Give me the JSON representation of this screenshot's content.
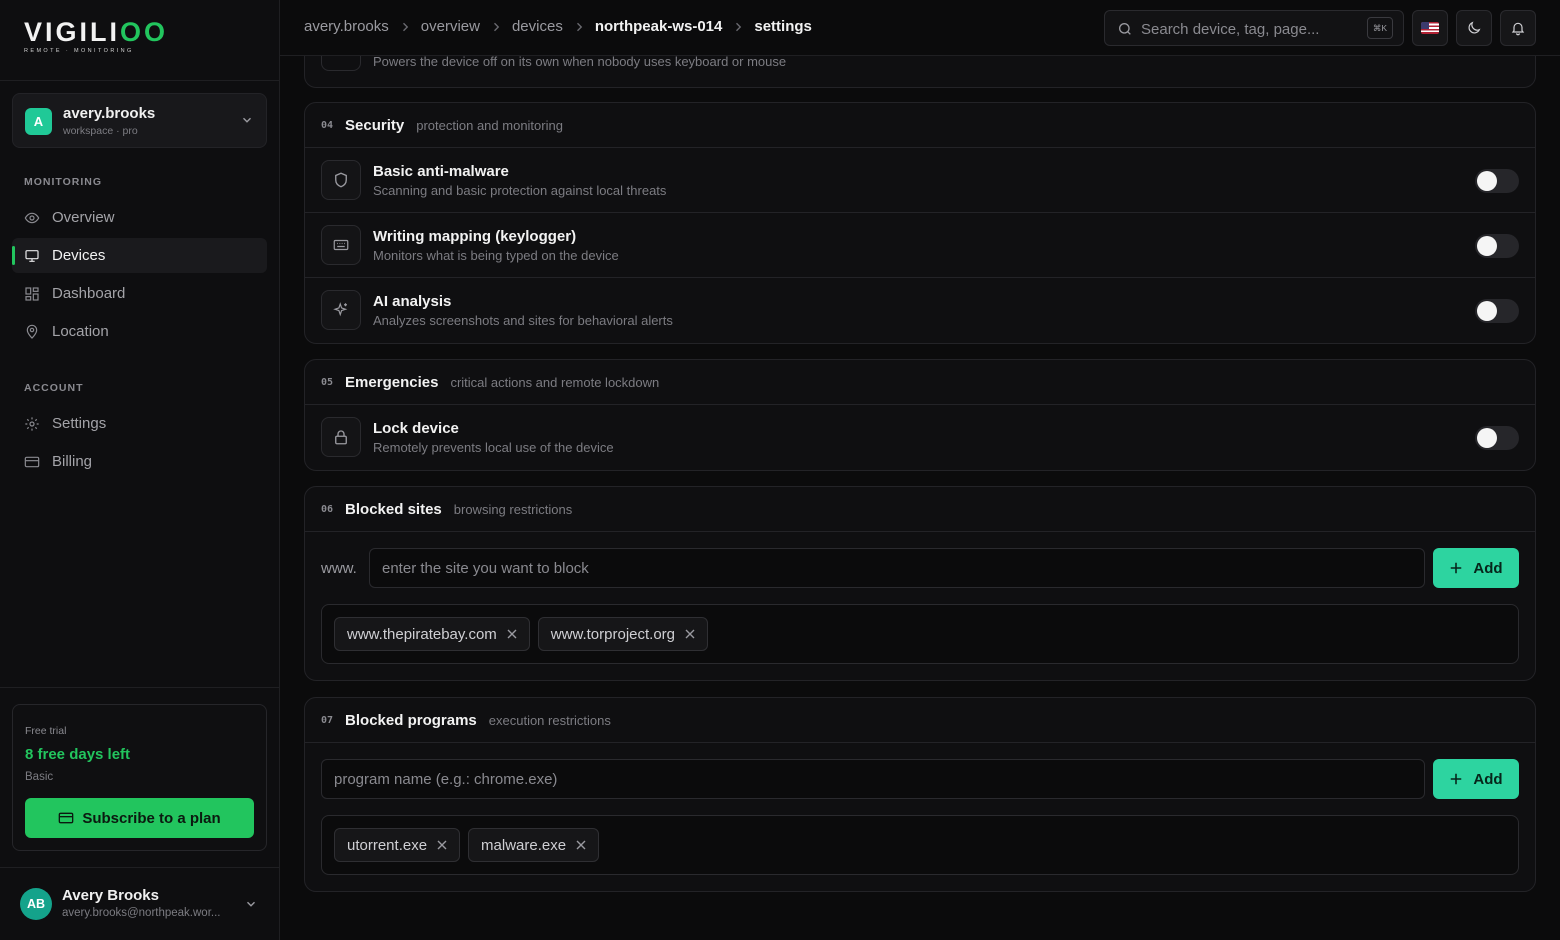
{
  "brand": {
    "name_main": "VIGILI",
    "name_accent": "OO",
    "tagline": "REMOTE · MONITORING"
  },
  "workspace": {
    "initial": "A",
    "name": "avery.brooks",
    "subtitle": "workspace · pro"
  },
  "sidebar": {
    "monitoring_label": "MONITORING",
    "monitoring_items": [
      {
        "label": "Overview",
        "icon": "eye-icon"
      },
      {
        "label": "Devices",
        "icon": "monitor-icon",
        "active": true
      },
      {
        "label": "Dashboard",
        "icon": "grid-icon"
      },
      {
        "label": "Location",
        "icon": "map-pin-icon"
      }
    ],
    "account_label": "ACCOUNT",
    "account_items": [
      {
        "label": "Settings",
        "icon": "gear-icon"
      },
      {
        "label": "Billing",
        "icon": "credit-card-icon"
      }
    ]
  },
  "trial": {
    "label": "Free trial",
    "days_left": "8 free days left",
    "plan": "Basic",
    "cta": "Subscribe to a plan"
  },
  "user": {
    "initials": "AB",
    "name": "Avery Brooks",
    "email": "avery.brooks@northpeak.wor..."
  },
  "breadcrumb": [
    "avery.brooks",
    "overview",
    "devices",
    "northpeak-ws-014",
    "settings"
  ],
  "search": {
    "placeholder": "Search device, tag, page...",
    "shortcut": "⌘K"
  },
  "partial_row": {
    "description": "Powers the device off on its own when nobody uses keyboard or mouse",
    "enabled": false
  },
  "security": {
    "number": "04",
    "title": "Security",
    "subtitle": "protection and monitoring",
    "rows": [
      {
        "title": "Basic anti-malware",
        "description": "Scanning and basic protection against local threats",
        "icon": "shield-icon",
        "enabled": false
      },
      {
        "title": "Writing mapping (keylogger)",
        "description": "Monitors what is being typed on the device",
        "icon": "keyboard-icon",
        "enabled": false
      },
      {
        "title": "AI analysis",
        "description": "Analyzes screenshots and sites for behavioral alerts",
        "icon": "sparkle-icon",
        "enabled": false
      }
    ]
  },
  "emergencies": {
    "number": "05",
    "title": "Emergencies",
    "subtitle": "critical actions and remote lockdown",
    "rows": [
      {
        "title": "Lock device",
        "description": "Remotely prevents local use of the device",
        "icon": "lock-icon",
        "enabled": false
      }
    ]
  },
  "blocked_sites": {
    "number": "06",
    "title": "Blocked sites",
    "subtitle": "browsing restrictions",
    "prefix": "www.",
    "placeholder": "enter the site you want to block",
    "add_label": "Add",
    "items": [
      "www.thepiratebay.com",
      "www.torproject.org"
    ]
  },
  "blocked_programs": {
    "number": "07",
    "title": "Blocked programs",
    "subtitle": "execution restrictions",
    "placeholder": "program name (e.g.: chrome.exe)",
    "add_label": "Add",
    "items": [
      "utorrent.exe",
      "malware.exe"
    ]
  },
  "colors": {
    "accent": "#22c55e",
    "add_button": "#2dd4a0",
    "background": "#0b0b0c"
  }
}
